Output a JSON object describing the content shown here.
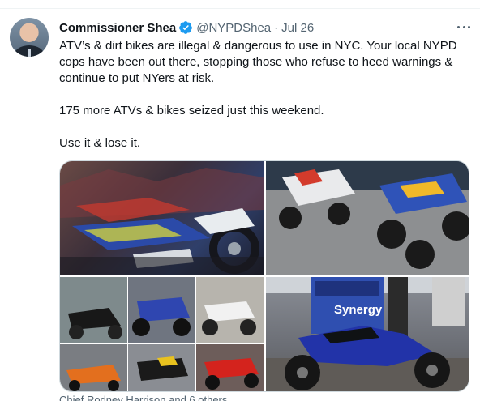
{
  "tweet": {
    "author_name": "Commissioner Shea",
    "author_handle": "@NYPDShea",
    "separator": "·",
    "date": "Jul 26",
    "paragraphs": [
      "ATV’s & dirt bikes are illegal & dangerous to use in NYC. Your local NYPD cops have been out there, stopping those who refuse to heed warnings & continue to put NYers at risk.",
      "175 more ATVs & bikes seized just this weekend.",
      "Use it & lose it."
    ],
    "photo_sign_text": "Synergy",
    "liked_by": "Chief Rodney Harrison and 6 others"
  },
  "colors": {
    "text_primary": "#0f1419",
    "text_secondary": "#536471",
    "verified_blue": "#1d9bf0",
    "border": "#cfd9de"
  },
  "icons": {
    "verified": "verified-badge-icon",
    "more": "more-options-icon"
  }
}
